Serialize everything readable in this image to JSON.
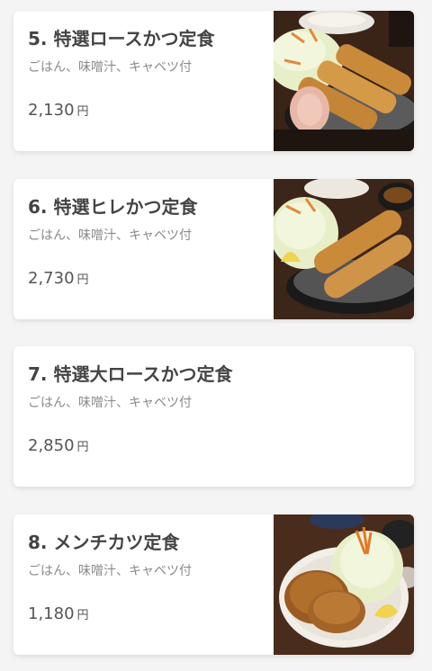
{
  "menu": {
    "items": [
      {
        "title": "5. 特選ロースかつ定食",
        "description": "ごはん、味噌汁、キャベツ付",
        "price": "2,130",
        "currency": "円",
        "photo": "loin-cutlet-photo"
      },
      {
        "title": "6. 特選ヒレかつ定食",
        "description": "ごはん、味噌汁、キャベツ付",
        "price": "2,730",
        "currency": "円",
        "photo": "fillet-cutlet-photo"
      },
      {
        "title": "7. 特選大ロースかつ定食",
        "description": "ごはん、味噌汁、キャベツ付",
        "price": "2,850",
        "currency": "円",
        "photo": null
      },
      {
        "title": "8. メンチカツ定食",
        "description": "ごはん、味噌汁、キャベツ付",
        "price": "1,180",
        "currency": "円",
        "photo": "menchi-katsu-photo"
      }
    ]
  },
  "colors": {
    "background": "#f4f4f4",
    "card": "#ffffff",
    "title": "#444444",
    "description": "#8a8a8a",
    "cutlet": "#c98a3a",
    "cabbage": "#e7efc8"
  }
}
